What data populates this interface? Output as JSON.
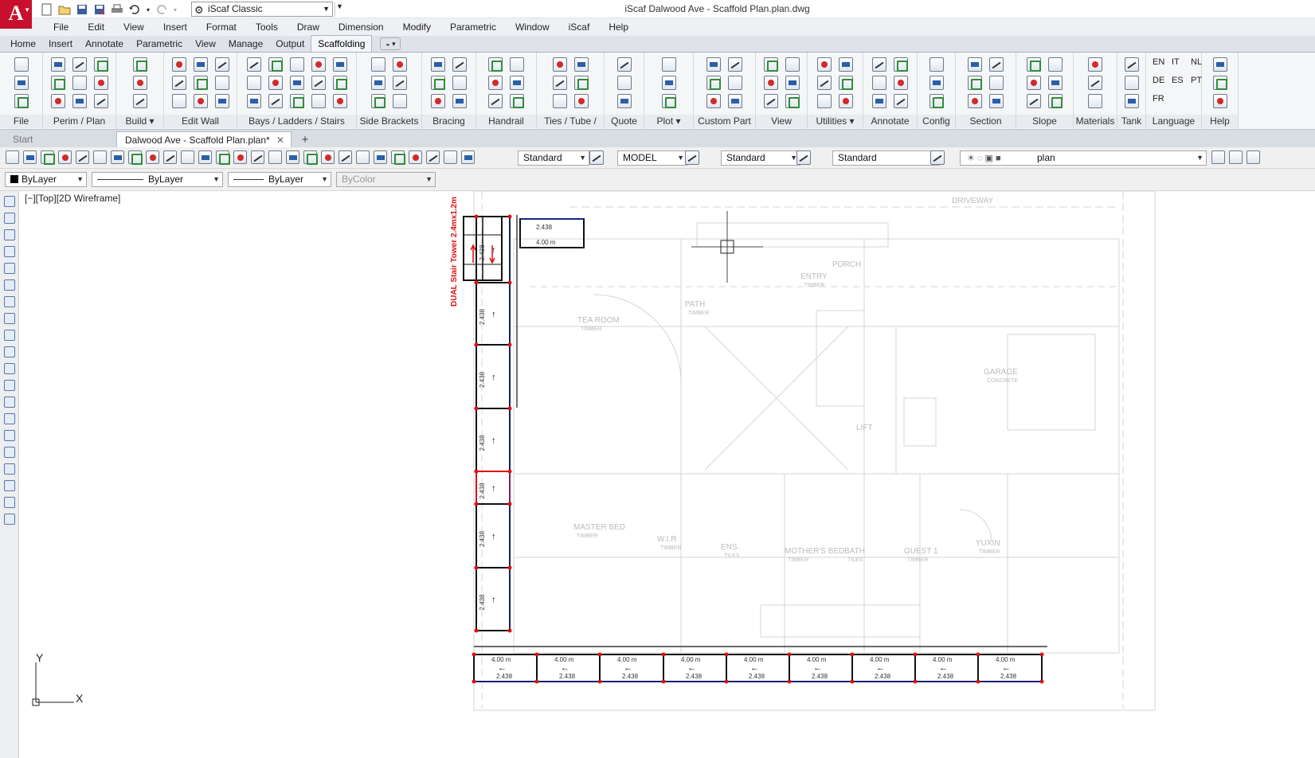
{
  "app": {
    "logo_letter": "A",
    "workspace": "iScaf Classic",
    "window_title": "iScaf   Dalwood Ave  -  Scaffold  Plan.plan.dwg"
  },
  "menu": [
    "File",
    "Edit",
    "View",
    "Insert",
    "Format",
    "Tools",
    "Draw",
    "Dimension",
    "Modify",
    "Parametric",
    "Window",
    "iScaf",
    "Help"
  ],
  "ribbon_tabs": [
    "Home",
    "Insert",
    "Annotate",
    "Parametric",
    "View",
    "Manage",
    "Output",
    "Scaffolding"
  ],
  "ribbon_active_tab": "Scaffolding",
  "ribbon_panels": [
    {
      "title": "File",
      "dropdown": false
    },
    {
      "title": "Perim / Plan",
      "dropdown": false
    },
    {
      "title": "Build",
      "dropdown": true
    },
    {
      "title": "Edit Wall",
      "dropdown": false
    },
    {
      "title": "Bays /  Ladders / Stairs",
      "dropdown": false
    },
    {
      "title": "Side Brackets",
      "dropdown": false
    },
    {
      "title": "Bracing",
      "dropdown": false
    },
    {
      "title": "Handrail",
      "dropdown": false
    },
    {
      "title": "Ties / Tube / Laps",
      "dropdown": false
    },
    {
      "title": "Quote",
      "dropdown": false
    },
    {
      "title": "Plot",
      "dropdown": true
    },
    {
      "title": "Custom Part",
      "dropdown": false
    },
    {
      "title": "View",
      "dropdown": false
    },
    {
      "title": "Utilities",
      "dropdown": true
    },
    {
      "title": "Annotate",
      "dropdown": false
    },
    {
      "title": "Config",
      "dropdown": false
    },
    {
      "title": "Section",
      "dropdown": false
    },
    {
      "title": "Slope",
      "dropdown": false
    },
    {
      "title": "Materials",
      "dropdown": false
    },
    {
      "title": "Tank",
      "dropdown": false
    },
    {
      "title": "Language",
      "dropdown": false
    },
    {
      "title": "Help",
      "dropdown": false
    }
  ],
  "languages": [
    "EN",
    "IT",
    "NL",
    "DE",
    "ES",
    "PT",
    "FR"
  ],
  "doc_tabs": {
    "start": "Start",
    "active": "Dalwood Ave  -  Scaffold  Plan.plan*",
    "add": "+"
  },
  "toolbar1": {
    "text_style": "Standard",
    "space": "MODEL",
    "dim_style": "Standard",
    "table_style": "Standard",
    "layer": "plan"
  },
  "toolbar2": {
    "color": "ByLayer",
    "linetype": "ByLayer",
    "lineweight": "ByLayer",
    "plotstyle": "ByColor"
  },
  "viewport": {
    "label": "[−][Top][2D Wireframe]",
    "ucs_x": "X",
    "ucs_y": "Y"
  },
  "drawing": {
    "stair_tower_label": "DUAL Stair Tower 2.4mx1.2m",
    "rooms": [
      {
        "name": "TEA ROOM",
        "sub": "TIMBER"
      },
      {
        "name": "PATH",
        "sub": "TIMBER"
      },
      {
        "name": "ENTRY",
        "sub": "TIMBER"
      },
      {
        "name": "GARAGE",
        "sub": "CONCRETE"
      },
      {
        "name": "MASTER BED",
        "sub": "TIMBER"
      },
      {
        "name": "W.I.R",
        "sub": "TIMBER"
      },
      {
        "name": "MOTHER'S BED",
        "sub": "TIMBER"
      },
      {
        "name": "BATH",
        "sub": "TILES"
      },
      {
        "name": "GUEST 1",
        "sub": "TIMBER"
      },
      {
        "name": "YUXIN",
        "sub": "TIMBER"
      },
      {
        "name": "DRIVEWAY",
        "sub": ""
      },
      {
        "name": "PORCH",
        "sub": ""
      },
      {
        "name": "ENS.",
        "sub": "TILES"
      },
      {
        "name": "LIFT",
        "sub": ""
      }
    ],
    "bay_label_vertical": "2.438",
    "bay_label_horizontal": "2.438",
    "bay_height": "4.00 m"
  }
}
